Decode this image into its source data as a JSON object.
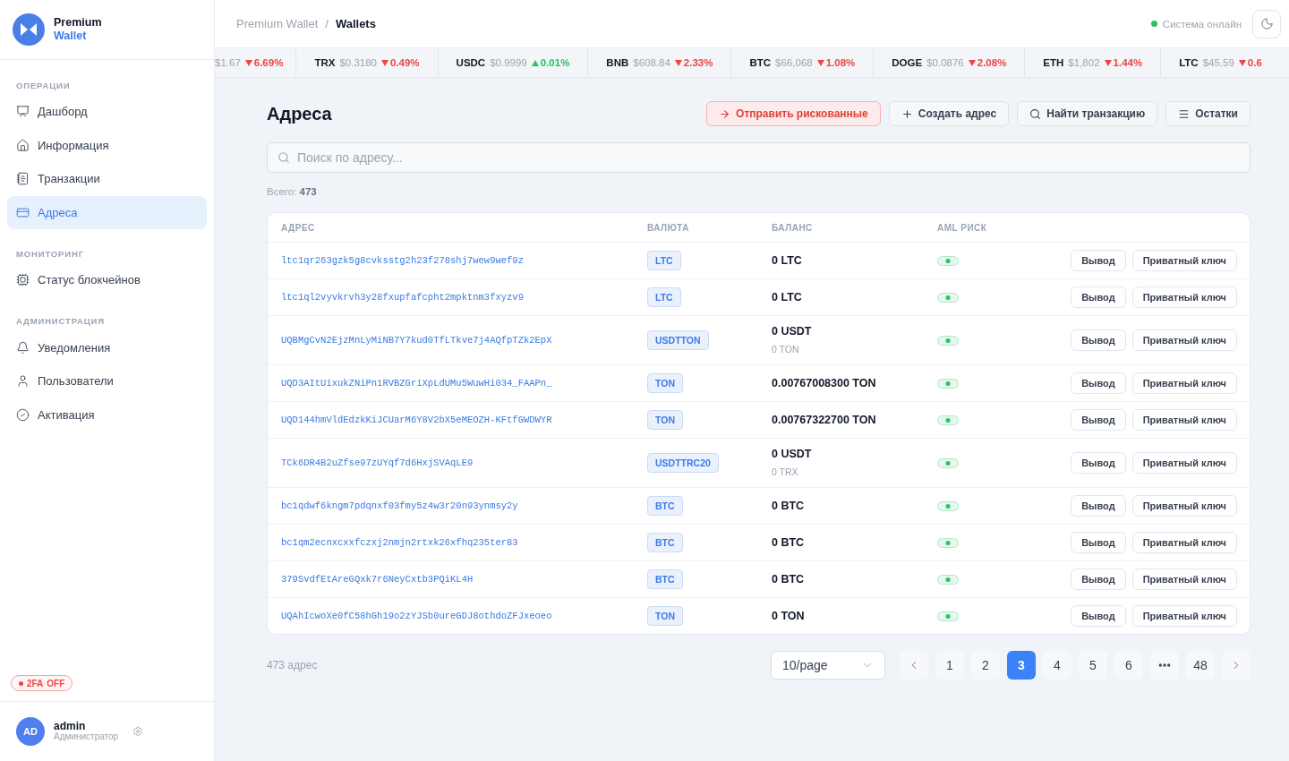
{
  "sidebar": {
    "brand": {
      "title": "Premium",
      "subtitle": "Wallet"
    },
    "sections": [
      {
        "label": "ОПЕРАЦИИ",
        "items": [
          {
            "label": "Дашборд",
            "selected": false
          },
          {
            "label": "Информация",
            "selected": false
          },
          {
            "label": "Транзакции",
            "selected": false
          },
          {
            "label": "Адреса",
            "selected": true
          }
        ]
      },
      {
        "label": "МОНИТОРИНГ",
        "items": [
          {
            "label": "Статус блокчейнов",
            "selected": false
          }
        ]
      },
      {
        "label": "АДМИНИСТРАЦИЯ",
        "items": [
          {
            "label": "Уведомления",
            "selected": false
          },
          {
            "label": "Пользователи",
            "selected": false
          },
          {
            "label": "Активация",
            "selected": false
          }
        ]
      }
    ],
    "two_factor": {
      "label": "2FA",
      "status": "OFF",
      "enabled": false
    },
    "user": {
      "initials": "AD",
      "name": "admin",
      "role": "Администратор"
    }
  },
  "header": {
    "breadcrumb": {
      "items": [
        "Premium Wallet",
        "Wallets"
      ],
      "separator": "/"
    },
    "status": {
      "label": "Система онлайн",
      "online": true
    }
  },
  "ticker": [
    {
      "price": "$1.67",
      "change": "6.69%",
      "up": false
    },
    {
      "symbol": "TRX",
      "price": "$0.3180",
      "change": "0.49%",
      "up": false
    },
    {
      "symbol": "USDC",
      "price": "$0.9999",
      "change": "0.01%",
      "up": true
    },
    {
      "symbol": "BNB",
      "price": "$608.84",
      "change": "2.33%",
      "up": false
    },
    {
      "symbol": "BTC",
      "price": "$66,068",
      "change": "1.08%",
      "up": false
    },
    {
      "symbol": "DOGE",
      "price": "$0.0876",
      "change": "2.08%",
      "up": false
    },
    {
      "symbol": "ETH",
      "price": "$1,802",
      "change": "1.44%",
      "up": false
    },
    {
      "symbol": "LTC",
      "price": "$45.59",
      "change": "0.6",
      "up": false
    }
  ],
  "page": {
    "title": "Адреса",
    "actions": [
      {
        "label": "Отправить рискованные",
        "kind": "danger"
      },
      {
        "label": "Создать адрес",
        "kind": "default"
      },
      {
        "label": "Найти транзакцию",
        "kind": "default"
      },
      {
        "label": "Остатки",
        "kind": "default"
      }
    ],
    "search": {
      "placeholder": "Поиск по адресу..."
    },
    "total": "Всего: **473**"
  },
  "table": {
    "columns": [
      "АДРЕС",
      "ВАЛЮТА",
      "БАЛАНС",
      "AML РИСК"
    ],
    "rows": [
      {
        "address": "ltc1qr263gzk5g8cvksstg2h23f278shj7wew9wef9z",
        "currency": "LTC",
        "balance": "0 LTC",
        "risky": false,
        "actions": [
          "Вывод",
          "Приватный ключ"
        ]
      },
      {
        "address": "ltc1ql2vyvkrvh3y28fxupfafcpht2mpktnm3fxyzv9",
        "currency": "LTC",
        "balance": "0 LTC",
        "risky": false,
        "actions": [
          "Вывод",
          "Приватный ключ"
        ]
      },
      {
        "address": "UQBMgCvN2EjzMnLyMiNB7Y7kud0TfLTkve7j4AQfpTZk2EpX",
        "currency": "USDTTON",
        "balance": "0 USDT",
        "sub_balance": "0 TON",
        "risky": false,
        "actions": [
          "Вывод",
          "Приватный ключ"
        ]
      },
      {
        "address": "UQD3AItUixukZNiPn1RVBZGriXpLdUMu5WuwHi034_FAAPn_",
        "currency": "TON",
        "balance": "0.00767008300 TON",
        "risky": false,
        "actions": [
          "Вывод",
          "Приватный ключ"
        ]
      },
      {
        "address": "UQD144hmVldEdzkKiJCUarM6Y8V2bX5eMEOZH-KFtfGWDWYR",
        "currency": "TON",
        "balance": "0.00767322700 TON",
        "risky": false,
        "actions": [
          "Вывод",
          "Приватный ключ"
        ]
      },
      {
        "address": "TCk6DR4B2uZfse97zUYqf7d6HxjSVAqLE9",
        "currency": "USDTTRC20",
        "balance": "0 USDT",
        "sub_balance": "0 TRX",
        "risky": false,
        "actions": [
          "Вывод",
          "Приватный ключ"
        ]
      },
      {
        "address": "bc1qdwf6kngm7pdqnxf03fmy5z4w3r20n93ynmsy2y",
        "currency": "BTC",
        "balance": "0 BTC",
        "risky": false,
        "actions": [
          "Вывод",
          "Приватный ключ"
        ]
      },
      {
        "address": "bc1qm2ecnxcxxfczxj2nmjn2rtxk26xfhq235ter83",
        "currency": "BTC",
        "balance": "0 BTC",
        "risky": false,
        "actions": [
          "Вывод",
          "Приватный ключ"
        ]
      },
      {
        "address": "379SvdfEtAreGQxk7r6NeyCxtb3PQiKL4H",
        "currency": "BTC",
        "balance": "0 BTC",
        "risky": false,
        "actions": [
          "Вывод",
          "Приватный ключ"
        ]
      },
      {
        "address": "UQAhIcwoXe0fC58hGh19o2zYJSb0ureGDJ8othdoZFJxeoeo",
        "currency": "TON",
        "balance": "0 TON",
        "risky": false,
        "actions": [
          "Вывод",
          "Приватный ключ"
        ]
      }
    ]
  },
  "pagination": {
    "summary": "473 адрес",
    "page_size": "10/page",
    "pages": [
      {
        "kind": "page",
        "label": "1",
        "selected": false
      },
      {
        "kind": "page",
        "label": "2",
        "selected": false
      },
      {
        "kind": "page",
        "label": "3",
        "selected": true
      },
      {
        "kind": "page",
        "label": "4",
        "selected": false
      },
      {
        "kind": "page",
        "label": "5",
        "selected": false
      },
      {
        "kind": "page",
        "label": "6",
        "selected": false
      },
      {
        "kind": "ellipsis",
        "selected": false
      },
      {
        "kind": "page",
        "label": "48",
        "selected": false
      }
    ]
  }
}
